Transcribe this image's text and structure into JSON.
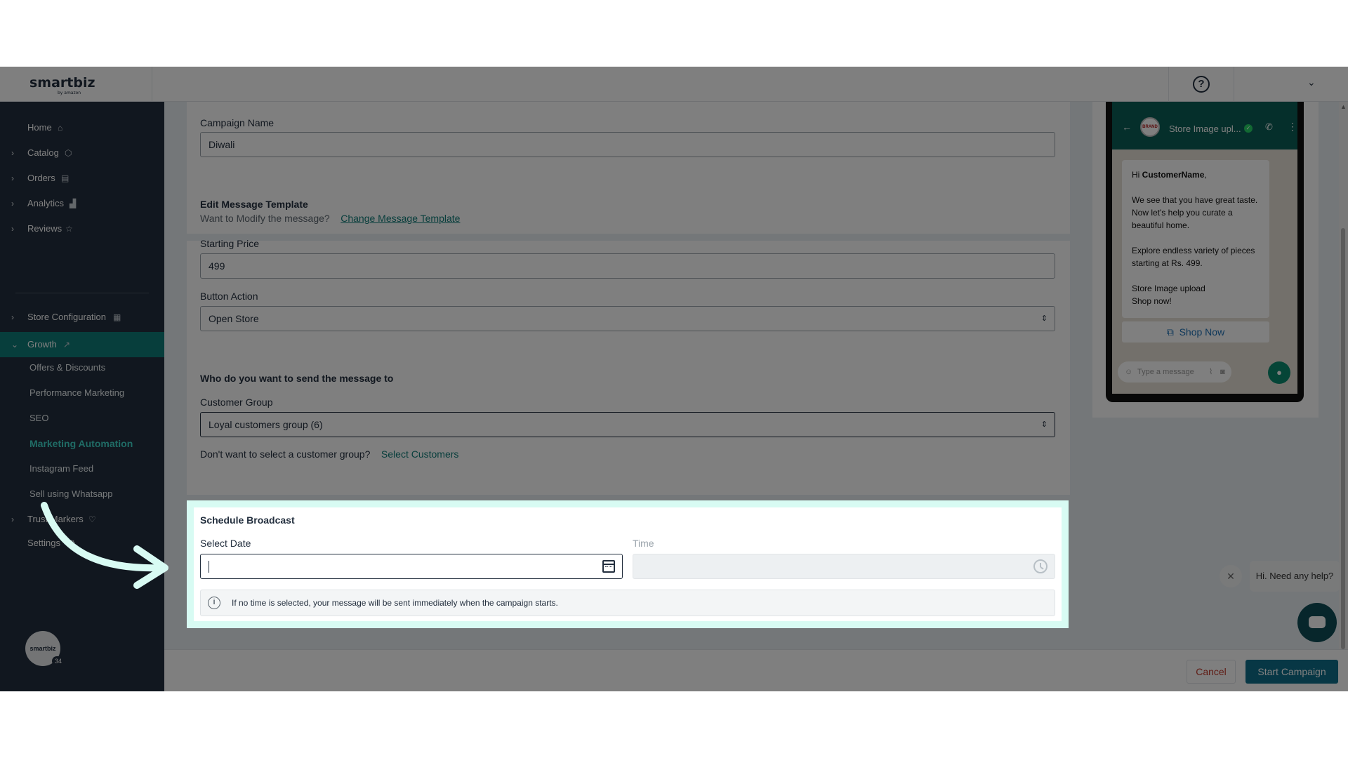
{
  "header": {
    "logo": "smartbiz",
    "logo_sub": "by amazon",
    "help_symbol": "?",
    "menu_chevron": "⌄"
  },
  "sidebar": {
    "items": [
      {
        "label": "Home",
        "icon": "home-icon"
      },
      {
        "label": "Catalog",
        "icon": "cube-icon"
      },
      {
        "label": "Orders",
        "icon": "clipboard-icon"
      },
      {
        "label": "Analytics",
        "icon": "bar-chart-icon"
      },
      {
        "label": "Reviews",
        "icon": "star-icon"
      },
      {
        "label": "Store Configuration",
        "icon": "store-icon"
      },
      {
        "label": "Growth",
        "icon": "trending-up-icon"
      },
      {
        "label": "Trust Markers",
        "icon": "heart-shield-icon"
      },
      {
        "label": "Settings",
        "icon": "gear-icon"
      }
    ],
    "growth_sub": [
      "Offers & Discounts",
      "Performance Marketing",
      "SEO",
      "Marketing Automation",
      "Instagram Feed",
      "Sell using Whatsapp"
    ],
    "avatar_text": "smartbiz",
    "avatar_badge": "34"
  },
  "form": {
    "campaign_name_label": "Campaign Name",
    "campaign_name_value": "Diwali",
    "edit_template_title": "Edit Message Template",
    "modify_prompt": "Want to Modify the message?",
    "change_template_link": "Change Message Template",
    "starting_price_label": "Starting Price",
    "starting_price_value": "499",
    "button_action_label": "Button Action",
    "button_action_value": "Open Store",
    "recipients_title": "Who do you want to send the message to",
    "customer_group_label": "Customer Group",
    "customer_group_value": "Loyal customers group (6)",
    "no_group_prompt": "Don't want to select a customer group?",
    "select_customers_link": "Select Customers"
  },
  "schedule": {
    "title": "Schedule Broadcast",
    "date_label": "Select Date",
    "date_value": "",
    "time_label": "Time",
    "time_value": "",
    "info_text": "If no time is selected, your message will be sent immediately when the campaign starts."
  },
  "preview": {
    "store_name": "Store Image upl...",
    "greeting_prefix": "Hi ",
    "customer_name": "CustomerName",
    "greeting_suffix": ",",
    "paragraph1": "We see that you have great taste. Now let's help you curate a beautiful home.",
    "paragraph2": "Explore endless variety of pieces starting at Rs. 499.",
    "line3a": "Store Image upload",
    "line3b": "Shop now!",
    "shop_button": "Shop Now",
    "input_placeholder": "Type a message",
    "avatar_text": "BRAND"
  },
  "help_widget": {
    "message": "Hi. Need any help?"
  },
  "footer": {
    "cancel_label": "Cancel",
    "start_label": "Start Campaign"
  }
}
